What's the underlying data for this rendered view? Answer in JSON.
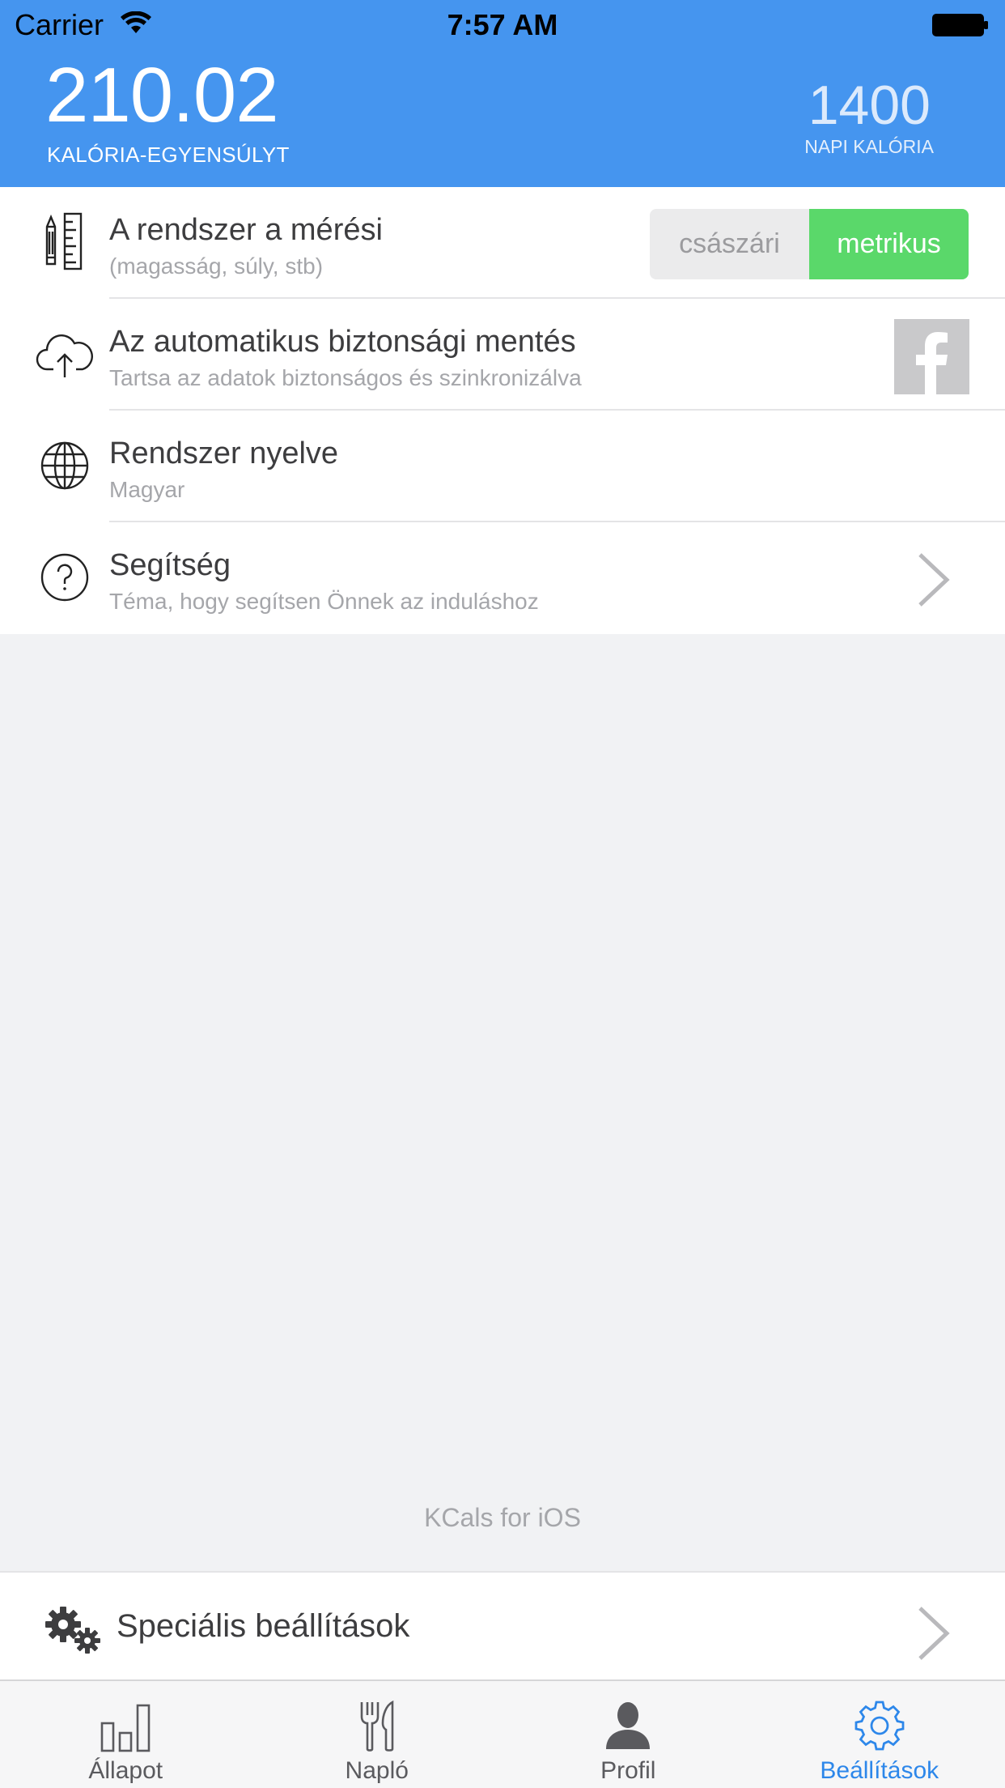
{
  "status_bar": {
    "carrier": "Carrier",
    "time": "7:57 AM"
  },
  "header": {
    "balance_value": "210.02",
    "balance_label": "KALÓRIA-EGYENSÚLYT",
    "daily_value": "1400",
    "daily_label": "NAPI KALÓRIA",
    "background_color": "#4595ef"
  },
  "settings": {
    "units": {
      "title": "A rendszer a mérési",
      "subtitle": "(magasság, súly, stb)",
      "icon": "ruler-pencil-icon",
      "options": [
        "császári",
        "metrikus"
      ],
      "selected": "metrikus",
      "selected_color": "#5ad86a"
    },
    "backup": {
      "title": "Az automatikus biztonsági mentés",
      "subtitle": "Tartsa az adatok biztonságos és szinkronizálva",
      "icon": "cloud-upload-icon",
      "action_icon": "facebook-icon"
    },
    "language": {
      "title": "Rendszer nyelve",
      "subtitle": "Magyar",
      "icon": "globe-icon"
    },
    "help": {
      "title": "Segítség",
      "subtitle": "Téma, hogy segítsen Önnek az induláshoz",
      "icon": "question-icon"
    }
  },
  "footer": {
    "app_name": "KCals for iOS"
  },
  "advanced": {
    "label": "Speciális beállítások",
    "icon": "gears-icon"
  },
  "tab_bar": {
    "active_color": "#2d87ea",
    "tabs": [
      {
        "label": "Állapot",
        "icon": "bar-chart-icon"
      },
      {
        "label": "Napló",
        "icon": "fork-knife-icon"
      },
      {
        "label": "Profil",
        "icon": "person-icon"
      },
      {
        "label": "Beállítások",
        "icon": "gear-icon",
        "active": true
      }
    ]
  }
}
